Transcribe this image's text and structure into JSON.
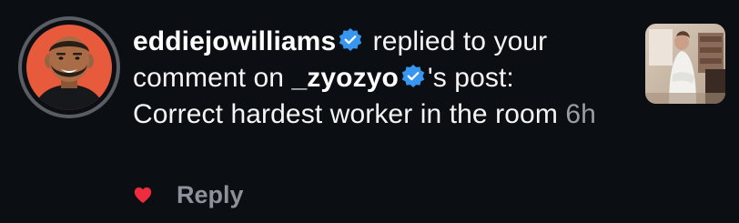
{
  "colors": {
    "background": "#0b0f13",
    "text": "#f5f5f5",
    "verified_badge": "#3797f0",
    "timestamp": "#9a9ea4",
    "reply": "#8e9298",
    "heart": "#ed2c3f",
    "avatar_background": "#e85a3c"
  },
  "notification": {
    "actor_username": "eddiejowilliams",
    "actor_verified_icon": "verified-badge",
    "action_text_1": " replied to your comment on ",
    "post_owner_username": "_zyozyo",
    "post_owner_verified_icon": "verified-badge",
    "action_text_2": "'s post: ",
    "reply_text": "Correct hardest worker in the room ",
    "timestamp": "6h"
  },
  "actions": {
    "like_icon": "heart-filled",
    "reply_label": "Reply"
  },
  "thumbnail_icon": "post-thumbnail"
}
